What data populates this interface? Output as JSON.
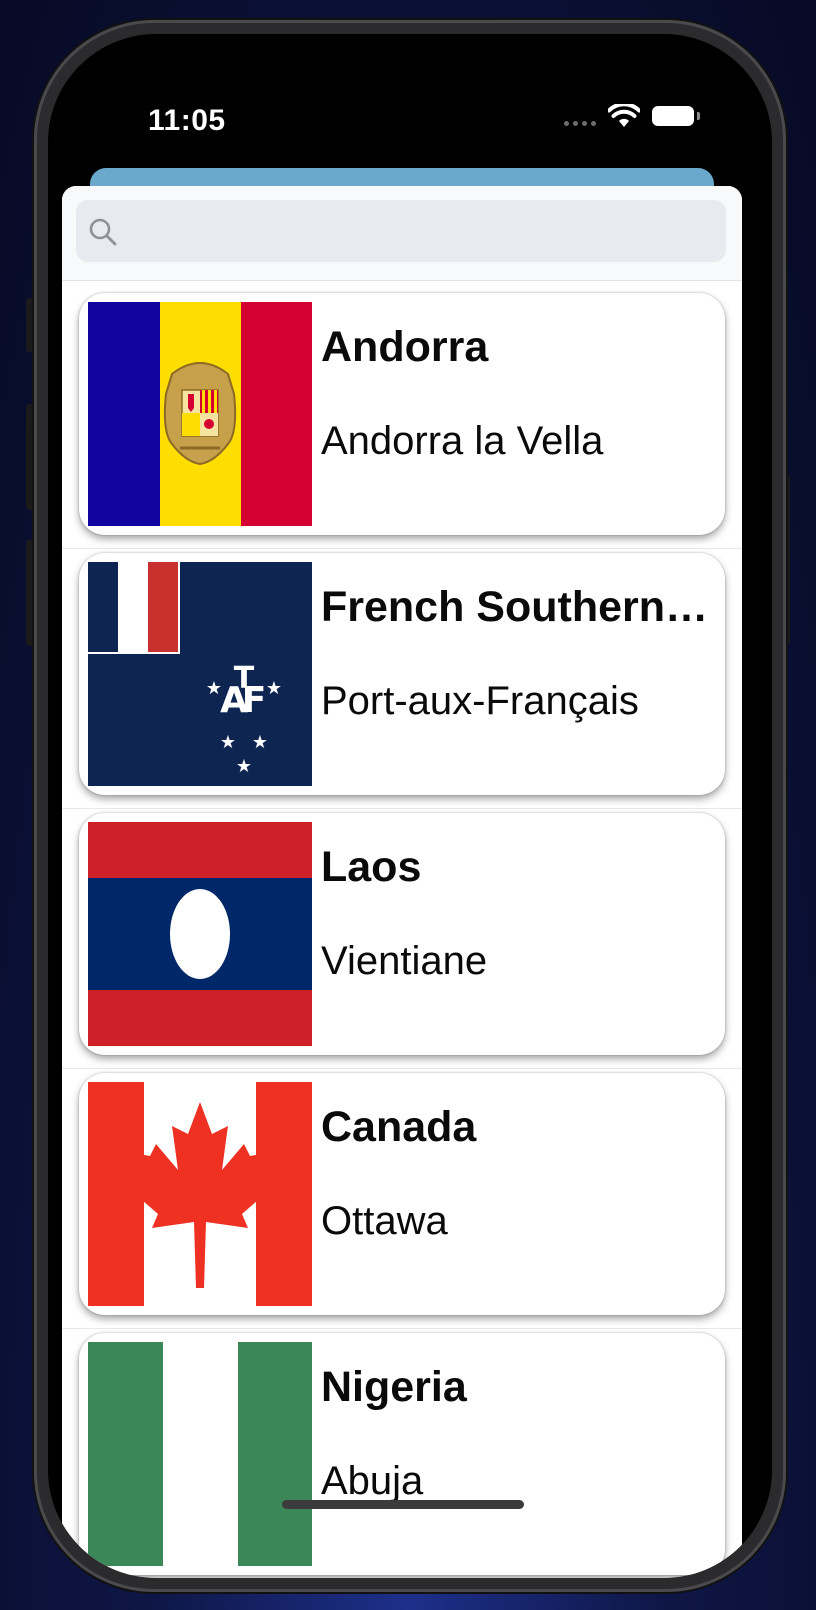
{
  "status_bar": {
    "time": "11:05"
  },
  "search": {
    "placeholder": ""
  },
  "countries": [
    {
      "name": "Andorra",
      "capital": "Andorra la Vella",
      "flag": "andorra-flag"
    },
    {
      "name": "French Southern and Antarctic Lands",
      "capital": "Port-aux-Français",
      "flag": "french-southern-territories-flag"
    },
    {
      "name": "Laos",
      "capital": "Vientiane",
      "flag": "laos-flag"
    },
    {
      "name": "Canada",
      "capital": "Ottawa",
      "flag": "canada-flag"
    },
    {
      "name": "Nigeria",
      "capital": "Abuja",
      "flag": "nigeria-flag"
    }
  ],
  "colors": {
    "sheet_accent": "#6aa8cc",
    "andorra": [
      "#10069f",
      "#fedd00",
      "#d50032"
    ],
    "taaf_blue": "#0e2552",
    "laos_red": "#ce2028",
    "laos_blue": "#002868",
    "canada_red": "#ef3124",
    "nigeria_green": "#3b8757"
  }
}
